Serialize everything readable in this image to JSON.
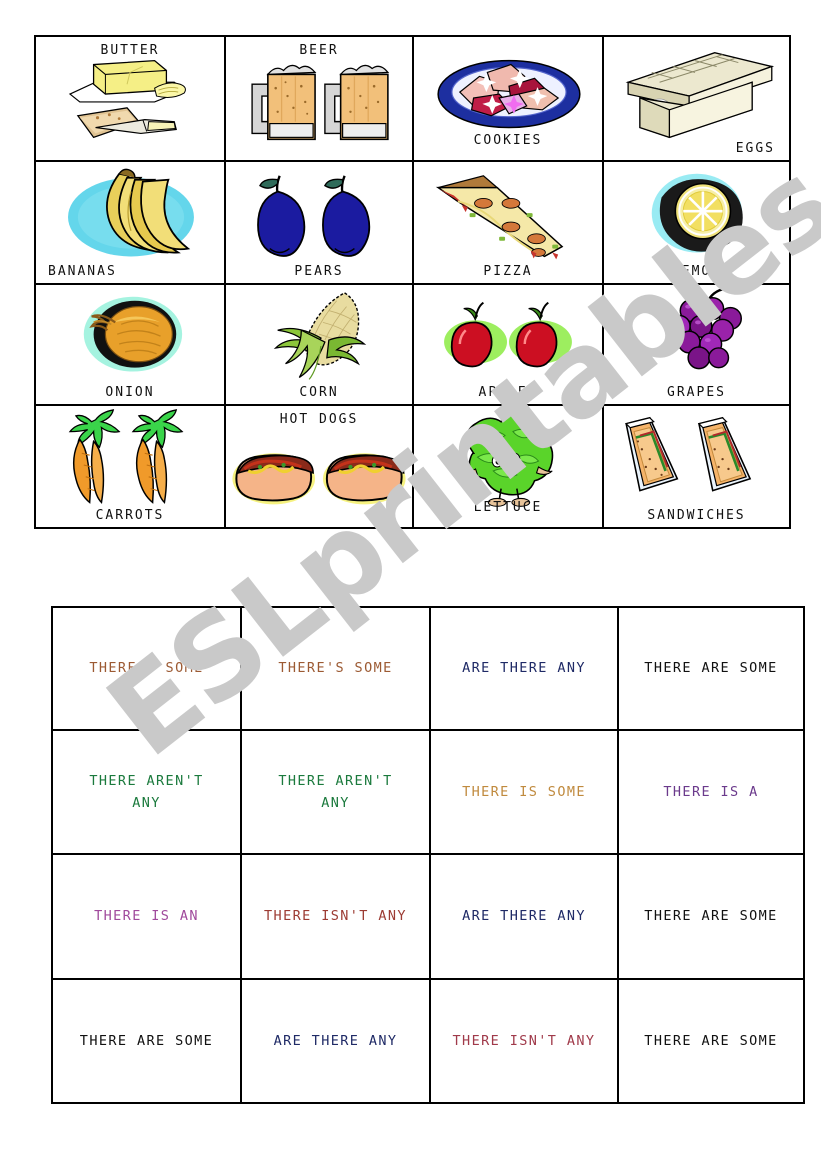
{
  "watermark": {
    "text": "ESLprintables.com",
    "color": "#c9c9c9"
  },
  "picture_grid": {
    "cells": [
      {
        "label": "BUTTER",
        "icon": "butter-icon",
        "label_position": "top"
      },
      {
        "label": "BEER",
        "icon": "beer-mugs-icon",
        "label_position": "top"
      },
      {
        "label": "COOKIES",
        "icon": "cookies-plate-icon",
        "label_position": "bottom-inset"
      },
      {
        "label": "EGGS",
        "icon": "egg-carton-icon",
        "label_position": "bottom-right"
      },
      {
        "label": "BANANAS",
        "icon": "bananas-icon",
        "label_position": "bottom-left"
      },
      {
        "label": "PEARS",
        "icon": "pears-icon",
        "label_position": "bottom"
      },
      {
        "label": "PIZZA",
        "icon": "pizza-slice-icon",
        "label_position": "bottom"
      },
      {
        "label": "LEMON",
        "icon": "lemon-icon",
        "label_position": "bottom"
      },
      {
        "label": "ONION",
        "icon": "onion-icon",
        "label_position": "bottom"
      },
      {
        "label": "CORN",
        "icon": "corn-icon",
        "label_position": "bottom"
      },
      {
        "label": "APPLES",
        "icon": "apples-icon",
        "label_position": "bottom"
      },
      {
        "label": "GRAPES",
        "icon": "grapes-icon",
        "label_position": "bottom"
      },
      {
        "label": "CARROTS",
        "icon": "carrots-icon",
        "label_position": "bottom"
      },
      {
        "label": "HOT DOGS",
        "icon": "hot-dogs-icon",
        "label_position": "top"
      },
      {
        "label": "LETTUCE",
        "icon": "lettuce-icon",
        "label_position": "bottom-inset"
      },
      {
        "label": "SANDWICHES",
        "icon": "sandwiches-icon",
        "label_position": "bottom"
      }
    ]
  },
  "sentence_grid": {
    "cells": [
      {
        "text": "THERE'S SOME",
        "color": "#9c5a33"
      },
      {
        "text": "THERE'S SOME",
        "color": "#9c5a33"
      },
      {
        "text": "ARE THERE ANY",
        "color": "#1f2a66"
      },
      {
        "text": "THERE ARE SOME",
        "color": "#111111"
      },
      {
        "text": "THERE AREN'T\nANY",
        "color": "#1b7a3d"
      },
      {
        "text": "THERE AREN'T\nANY",
        "color": "#1b7a3d"
      },
      {
        "text": "THERE IS SOME",
        "color": "#c08a3e"
      },
      {
        "text": "THERE IS   A",
        "color": "#6b3a8c"
      },
      {
        "text": "THERE IS   AN",
        "color": "#a04a9c"
      },
      {
        "text": "THERE ISN'T ANY",
        "color": "#9c3b33"
      },
      {
        "text": "ARE THERE ANY",
        "color": "#1f2a66"
      },
      {
        "text": "THERE ARE SOME",
        "color": "#111111"
      },
      {
        "text": "THERE ARE SOME",
        "color": "#111111"
      },
      {
        "text": "ARE THERE ANY",
        "color": "#1f2a66"
      },
      {
        "text": "THERE ISN'T ANY",
        "color": "#a03a4a"
      },
      {
        "text": "THERE ARE SOME",
        "color": "#111111"
      }
    ]
  }
}
